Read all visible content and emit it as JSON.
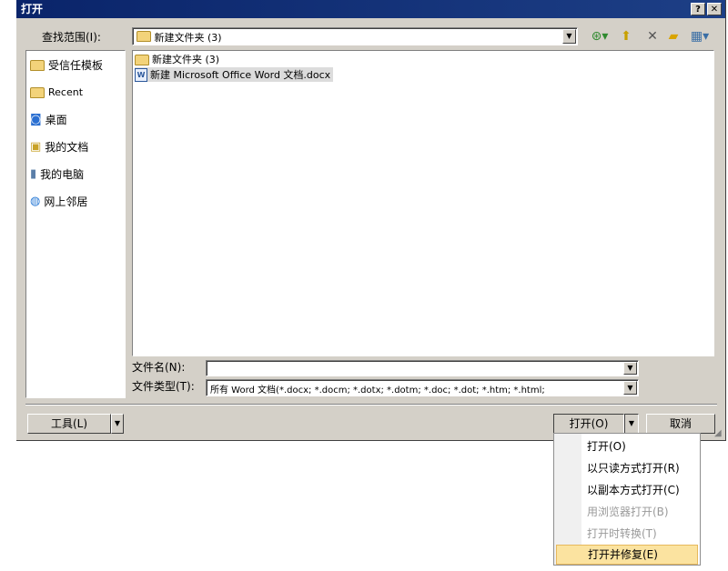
{
  "dialog": {
    "title": "打开",
    "help_label": "?",
    "close_label": "✕"
  },
  "lookin": {
    "label": "查找范围(I):",
    "value": "新建文件夹 (3)"
  },
  "toolbar": {
    "back_icon": "back-icon",
    "up_icon": "up-folder-icon",
    "delete_icon": "delete-icon",
    "newfolder_icon": "new-folder-icon",
    "views_icon": "views-icon"
  },
  "places": [
    {
      "label": "受信任模板",
      "icon": "folder-icon"
    },
    {
      "label": "Recent",
      "icon": "folder-icon"
    },
    {
      "label": "桌面",
      "icon": "desktop-icon"
    },
    {
      "label": "我的文档",
      "icon": "my-documents-icon"
    },
    {
      "label": "我的电脑",
      "icon": "my-computer-icon"
    },
    {
      "label": "网上邻居",
      "icon": "network-icon"
    }
  ],
  "files": [
    {
      "name": "新建文件夹 (3)",
      "icon": "folder-icon",
      "selected": false
    },
    {
      "name": "新建 Microsoft Office Word 文档.docx",
      "icon": "word-doc-icon",
      "selected": true
    }
  ],
  "filename": {
    "label": "文件名(N):",
    "value": ""
  },
  "filetype": {
    "label": "文件类型(T):",
    "value": "所有 Word 文档(*.docx; *.docm; *.dotx; *.dotm; *.doc; *.dot; *.htm; *.html;"
  },
  "buttons": {
    "tools": "工具(L)",
    "open": "打开(O)",
    "cancel": "取消"
  },
  "open_menu": [
    {
      "label": "打开(O)",
      "enabled": true,
      "highlighted": false
    },
    {
      "label": "以只读方式打开(R)",
      "enabled": true,
      "highlighted": false
    },
    {
      "label": "以副本方式打开(C)",
      "enabled": true,
      "highlighted": false
    },
    {
      "label": "用浏览器打开(B)",
      "enabled": false,
      "highlighted": false
    },
    {
      "label": "打开时转换(T)",
      "enabled": false,
      "highlighted": false
    },
    {
      "label": "打开并修复(E)",
      "enabled": true,
      "highlighted": true
    }
  ]
}
